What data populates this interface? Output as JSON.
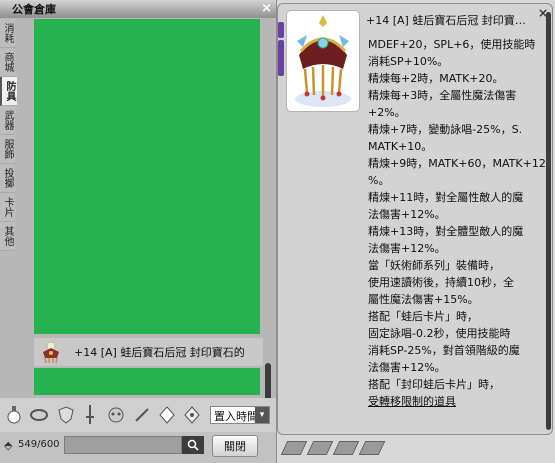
{
  "storage": {
    "title": "公會倉庫",
    "close_glyph": "×",
    "categories": [
      {
        "label": "消耗",
        "active": false
      },
      {
        "label": "商城",
        "active": false
      },
      {
        "label": "防具",
        "active": true
      },
      {
        "label": "武器",
        "active": false
      },
      {
        "label": "服飾",
        "active": false
      },
      {
        "label": "投擲",
        "active": false
      },
      {
        "label": "卡片",
        "active": false
      },
      {
        "label": "其他",
        "active": false
      }
    ],
    "selected_item": {
      "name": "+14 [A] 蛙后寶石后冠 封印寶石的",
      "icon": "crown-icon"
    },
    "filter_icons": [
      "potion-icon",
      "ring-icon",
      "shield-icon",
      "sword-icon",
      "costume-icon",
      "wand-icon",
      "card-icon",
      "misc-icon"
    ],
    "sort": {
      "label": "置入時間",
      "arrow": "▾"
    },
    "capacity": "549/600",
    "search": {
      "placeholder": "",
      "value": ""
    },
    "close_button": "關閉",
    "colors": {
      "grid_green": "#25b24f"
    }
  },
  "tooltip": {
    "close_glyph": "×",
    "item_name": "+14 [A] 蛙后寶石后冠 封印寶石的",
    "icon": "crown-icon",
    "description": [
      "MDEF+20，SPL+6，使用技能時",
      "消耗SP+10%。",
      "精煉每+2時，MATK+20。",
      "精煉每+3時，全屬性魔法傷害",
      "+2%。",
      "精煉+7時，變動詠唱-25%，S.",
      "MATK+10。",
      "精煉+9時，MATK+60，MATK+12",
      "%。",
      "精煉+11時，對全屬性敵人的魔",
      "法傷害+12%。",
      "精煉+13時，對全體型敵人的魔",
      "法傷害+12%。",
      "當「妖術師系列」裝備時，",
      "使用速讀術後，持續10秒，全",
      "屬性魔法傷害+15%。",
      "搭配「蛙后卡片」時，",
      "固定詠唱-0.2秒，使用技能時",
      "消耗SP-25%，對首領階級的魔",
      "法傷害+12%。",
      "搭配「封印蛙后卡片」時，",
      "受轉移限制的道具"
    ]
  },
  "tray": {
    "icons": [
      "card-slot-icon",
      "card-slot-icon",
      "card-slot-icon",
      "card-slot-icon"
    ]
  }
}
